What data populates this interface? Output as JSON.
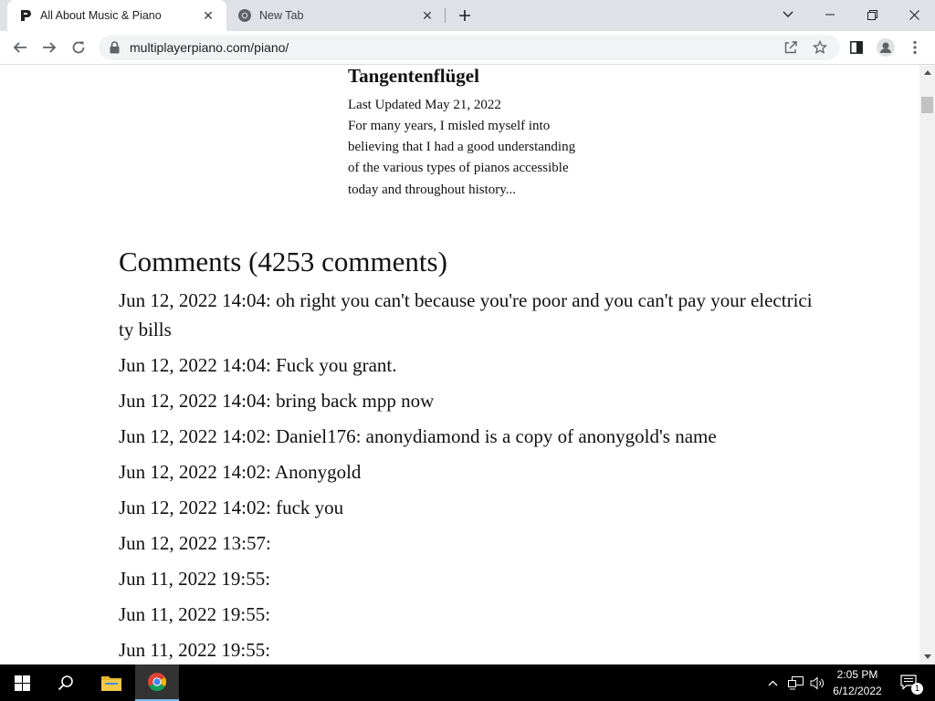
{
  "browser": {
    "tabs": [
      {
        "title": "All About Music & Piano",
        "active": true,
        "icon": "site-logo-icon"
      },
      {
        "title": "New Tab",
        "active": false,
        "icon": "chrome-icon"
      }
    ],
    "url": "multiplayerpiano.com/piano/"
  },
  "article": {
    "title": "Tangentenflügel",
    "date": "Last Updated May 21, 2022",
    "excerpt": "For many years, I misled myself into believing that I had a good understanding of the various types of pianos accessible today and throughout history..."
  },
  "comments": {
    "heading": "Comments (4253 comments)",
    "items": [
      "Jun 12, 2022 14:04: oh right you can't because you're poor and you can't pay your electricity bills",
      "Jun 12, 2022 14:04: Fuck you grant.",
      "Jun 12, 2022 14:04: bring back mpp now",
      "Jun 12, 2022 14:02: Daniel176: anonydiamond is a copy of anonygold's name",
      "Jun 12, 2022 14:02: Anonygold",
      "Jun 12, 2022 14:02: fuck you",
      "Jun 12, 2022 13:57:",
      "Jun 11, 2022 19:55:",
      "Jun 11, 2022 19:55:",
      "Jun 11, 2022 19:55:"
    ]
  },
  "taskbar": {
    "time": "2:05 PM",
    "date": "6/12/2022",
    "notification_count": "1"
  }
}
